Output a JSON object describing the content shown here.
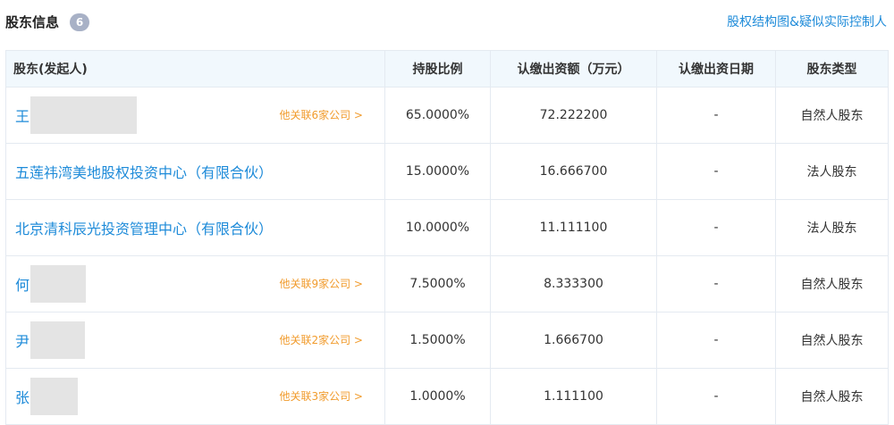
{
  "header": {
    "title": "股东信息",
    "count": "6",
    "structure_link": "股权结构图&疑似实际控制人"
  },
  "table": {
    "columns": [
      "股东(发起人)",
      "持股比例",
      "认缴出资额（万元）",
      "认缴出资日期",
      "股东类型"
    ],
    "rows": [
      {
        "name": "王",
        "related": "他关联6家公司 >",
        "ratio": "65.0000%",
        "amount": "72.222200",
        "date": "-",
        "type": "自然人股东"
      },
      {
        "name": "五莲祎湾美地股权投资中心（有限合伙）",
        "related": "",
        "ratio": "15.0000%",
        "amount": "16.666700",
        "date": "-",
        "type": "法人股东"
      },
      {
        "name": "北京清科辰光投资管理中心（有限合伙）",
        "related": "",
        "ratio": "10.0000%",
        "amount": "11.111100",
        "date": "-",
        "type": "法人股东"
      },
      {
        "name": "何",
        "related": "他关联9家公司 >",
        "ratio": "7.5000%",
        "amount": "8.333300",
        "date": "-",
        "type": "自然人股东"
      },
      {
        "name": "尹",
        "related": "他关联2家公司 >",
        "ratio": "1.5000%",
        "amount": "1.666700",
        "date": "-",
        "type": "自然人股东"
      },
      {
        "name": "张",
        "related": "他关联3家公司 >",
        "ratio": "1.0000%",
        "amount": "1.111100",
        "date": "-",
        "type": "自然人股东"
      }
    ]
  }
}
